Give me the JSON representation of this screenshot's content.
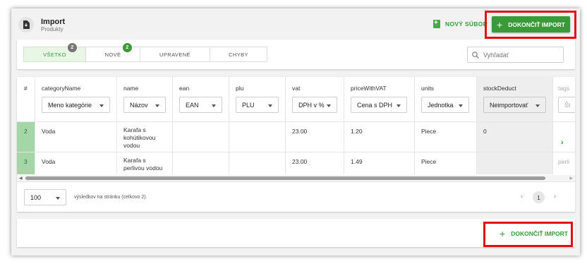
{
  "header": {
    "title": "Import",
    "subtitle": "Produkty",
    "new_file_label": "NOVÝ SÚBOR",
    "finish_label": "DOKONČIŤ IMPORT"
  },
  "tabs": [
    {
      "label": "VŠETKO",
      "badge": "2",
      "active": true
    },
    {
      "label": "NOVÉ",
      "badge": "2",
      "active": false
    },
    {
      "label": "UPRAVENÉ",
      "badge": "",
      "active": false
    },
    {
      "label": "CHYBY",
      "badge": "",
      "active": false
    }
  ],
  "search": {
    "placeholder": "Vyhľadať"
  },
  "table": {
    "columns": [
      {
        "key": "#",
        "select": ""
      },
      {
        "key": "categoryName",
        "select": "Meno kategórie"
      },
      {
        "key": "name",
        "select": "Názov"
      },
      {
        "key": "ean",
        "select": "EAN"
      },
      {
        "key": "plu",
        "select": "PLU"
      },
      {
        "key": "vat",
        "select": "DPH v %"
      },
      {
        "key": "priceWithVAT",
        "select": "Cena s DPH"
      },
      {
        "key": "units",
        "select": "Jednotka"
      },
      {
        "key": "stockDeduct",
        "select": "Neimportovať"
      },
      {
        "key": "tags",
        "select": "Št"
      }
    ],
    "rows": [
      {
        "num": "2",
        "categoryName": "Voda",
        "name": "Karafa s kohútikovou vodou",
        "ean": "",
        "plu": "",
        "vat": "23.00",
        "priceWithVAT": "1.20",
        "units": "Piece",
        "stockDeduct": "0",
        "tags": ""
      },
      {
        "num": "3",
        "categoryName": "Voda",
        "name": "Karafa s perlivou vodou",
        "ean": "",
        "plu": "",
        "vat": "23.00",
        "priceWithVAT": "1.49",
        "units": "Piece",
        "stockDeduct": "",
        "tags": "perli"
      }
    ]
  },
  "pagination": {
    "per_page": "100",
    "summary": "výsledkov na stránku (celkovo 2).",
    "current_page": "1"
  },
  "footer": {
    "finish_label": "DOKONČIŤ IMPORT"
  },
  "colors": {
    "accent": "#3a9a3a",
    "highlight": "#e01010",
    "row_number_bg": "#a5d6a7"
  }
}
